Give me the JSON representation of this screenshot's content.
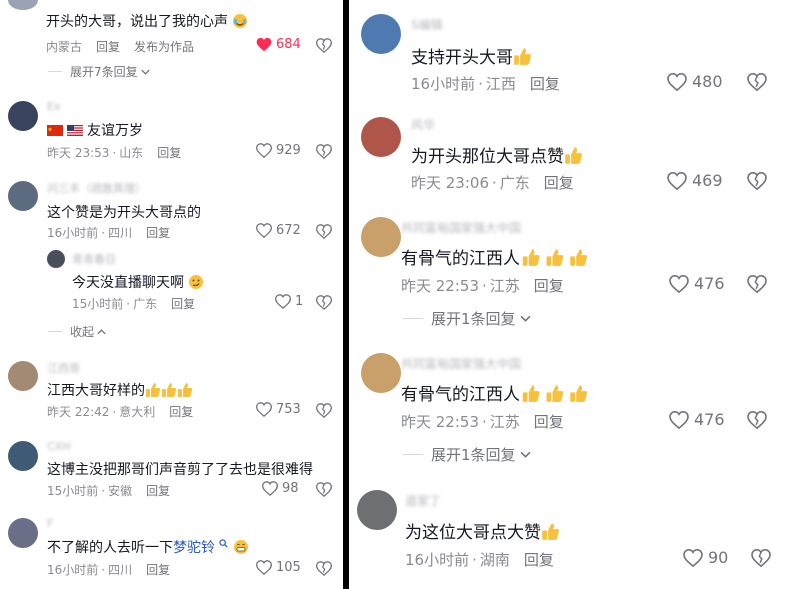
{
  "left": {
    "comments": [
      {
        "id": "c1",
        "text": "开头的大哥，说出了我的心声",
        "location": "内蒙古",
        "reply": "回复",
        "extra": "发布为作品",
        "likes": "684",
        "liked": true,
        "expand": "展开7条回复",
        "avatar_color": "#9aa3b5"
      },
      {
        "id": "c2",
        "username": "Ex",
        "text": "友谊万岁",
        "time": "昨天 23:53",
        "location": "山东",
        "reply": "回复",
        "likes": "929",
        "avatar_color": "#39435e"
      },
      {
        "id": "c3",
        "username": "问三丰（疏散真理）",
        "text": "这个赞是为开头大哥点的",
        "time": "16小时前",
        "location": "四川",
        "reply": "回复",
        "likes": "672",
        "avatar_color": "#5c6b7f"
      },
      {
        "id": "c3r",
        "username": "青青春日",
        "text": "今天没直播聊天啊",
        "time": "15小时前",
        "location": "广东",
        "reply": "回复",
        "likes": "1",
        "avatar_color": "#4a4f5c"
      },
      {
        "id": "collapse",
        "label": "收起"
      },
      {
        "id": "c4",
        "username": "江西哥",
        "text": "江西大哥好样的",
        "time": "昨天 22:42",
        "location": "意大利",
        "reply": "回复",
        "likes": "753",
        "avatar_color": "#a38a74"
      },
      {
        "id": "c5",
        "username": "CXH",
        "text": "这博主没把那哥们声音剪了了去也是很难得",
        "time": "15小时前",
        "location": "安徽",
        "reply": "回复",
        "likes": "98",
        "avatar_color": "#3f5a75"
      },
      {
        "id": "c6",
        "username": "F",
        "text_before": "不了解的人去听一下",
        "text_link": "梦驼铃",
        "time": "16小时前",
        "location": "四川",
        "reply": "回复",
        "likes": "105",
        "avatar_color": "#6a6e86"
      }
    ]
  },
  "right": {
    "comments": [
      {
        "id": "r1",
        "username": "S编辑",
        "text": "支持开头大哥",
        "time": "16小时前",
        "location": "江西",
        "reply": "回复",
        "likes": "480",
        "avatar_color": "#4f7ab0"
      },
      {
        "id": "r2",
        "username": "风华",
        "text": "为开头那位大哥点赞",
        "time": "昨天 23:06",
        "location": "广东",
        "reply": "回复",
        "likes": "469",
        "avatar_color": "#b0554a"
      },
      {
        "id": "r3",
        "username": "共同富裕国家强大中国",
        "text": "有骨气的江西人",
        "time": "昨天 22:53",
        "location": "江苏",
        "reply": "回复",
        "likes": "476",
        "expand": "展开1条回复",
        "avatar_color": "#c9a06a"
      },
      {
        "id": "r4",
        "username": "共同富裕国家强大中国",
        "text": "有骨气的江西人",
        "time": "昨天 22:53",
        "location": "江苏",
        "reply": "回复",
        "likes": "476",
        "expand": "展开1条回复",
        "avatar_color": "#c9a06a"
      },
      {
        "id": "r5",
        "username": "道家丁",
        "text": "为这位大哥点大赞",
        "time": "16小时前",
        "location": "湖南",
        "reply": "回复",
        "likes": "90",
        "avatar_color": "#6d6f72"
      }
    ]
  },
  "colors": {
    "liked_red": "#fe2c55",
    "thumb_yellow": "#f7c13d",
    "link_blue": "#2b5bb8"
  },
  "icons": [
    "heart-icon",
    "heart-filled-icon",
    "broken-heart-icon",
    "thumbs-up-emoji",
    "chevron-down-icon",
    "chevron-up-icon"
  ]
}
